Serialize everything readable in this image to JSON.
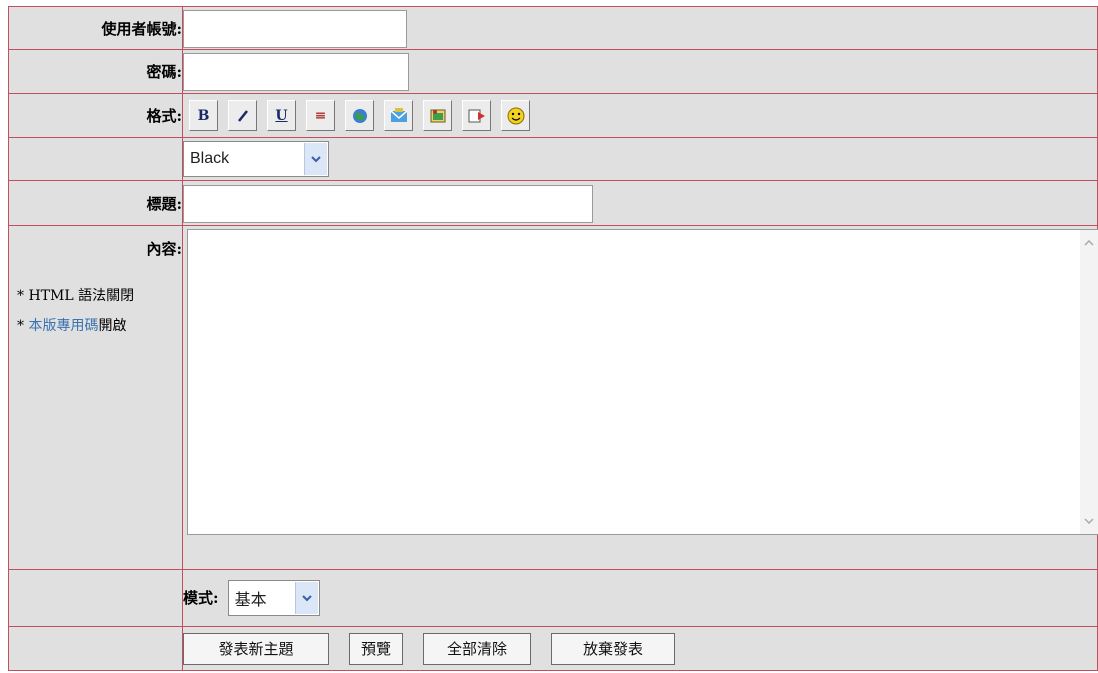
{
  "form": {
    "username_label": "使用者帳號:",
    "username_value": "",
    "password_label": "密碼:",
    "password_value": "",
    "format_label": "格式:",
    "toolbar": [
      {
        "name": "bold-button",
        "glyph": "B"
      },
      {
        "name": "italic-button",
        "glyph": "/"
      },
      {
        "name": "underline-button",
        "glyph": "U"
      },
      {
        "name": "center-button",
        "glyph": "≡"
      },
      {
        "name": "url-button",
        "icon": "globe-icon"
      },
      {
        "name": "email-button",
        "icon": "email-icon"
      },
      {
        "name": "image-button",
        "icon": "image-icon"
      },
      {
        "name": "flash-button",
        "icon": "flash-icon"
      },
      {
        "name": "smiley-button",
        "icon": "smiley-icon"
      }
    ],
    "color_select": {
      "value": "Black"
    },
    "title_label": "標題:",
    "title_value": "",
    "content_label": "內容:",
    "notes": {
      "html_prefix": "* HTML 語法關閉",
      "board_prefix": "* ",
      "board_link": "本版專用碼",
      "board_suffix": "開啟"
    },
    "content_value": "",
    "mode_label": "模式:",
    "mode_select": {
      "value": "基本"
    },
    "buttons": {
      "post": "發表新主題",
      "preview": "預覽",
      "clear": "全部清除",
      "cancel": "放棄發表"
    }
  },
  "colors": {
    "border": "#c0505f",
    "row_bg": "#e0e0e0",
    "link": "#3a73b0"
  }
}
